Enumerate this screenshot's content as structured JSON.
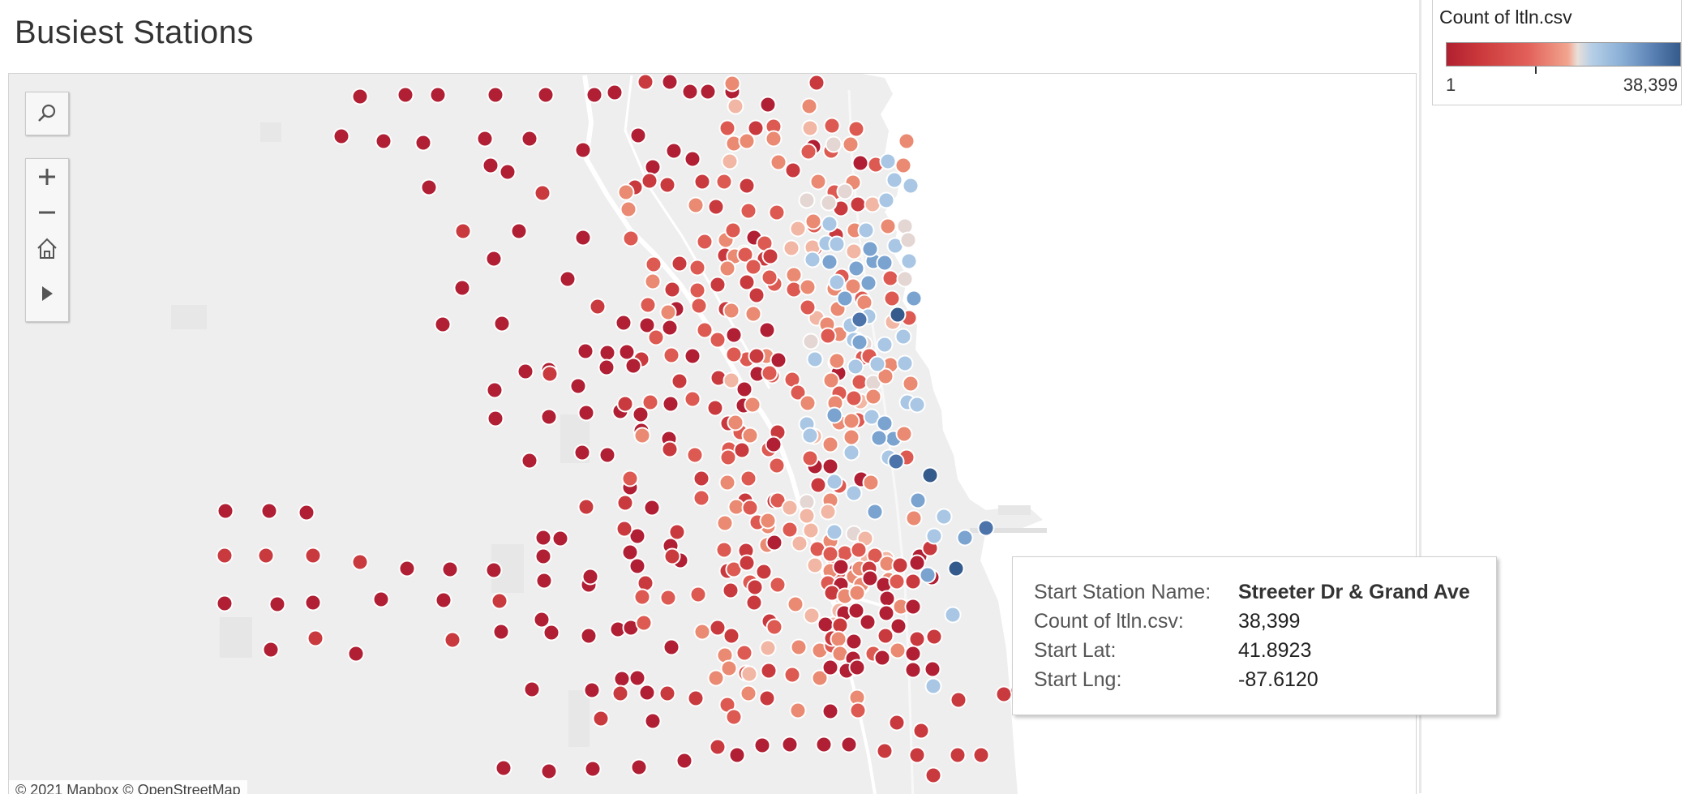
{
  "page_title": "Busiest Stations",
  "legend": {
    "title": "Count of ltln.csv",
    "min_label": "1",
    "max_label": "38,399",
    "color_low": "#b1202f",
    "color_mid": "#e9dfd9",
    "color_high": "#355a8c"
  },
  "map": {
    "attribution": "© 2021 Mapbox © OpenStreetMap",
    "colors": {
      "land": "#eeeeee",
      "water": "#ffffff",
      "roads": "#ffffff"
    },
    "controls": {
      "search_icon": "search-icon",
      "zoom_in_icon": "plus-icon",
      "zoom_out_icon": "minus-icon",
      "home_icon": "home-icon",
      "play_icon": "play-icon"
    }
  },
  "tooltip": {
    "rows": [
      {
        "key": "Start Station Name:",
        "value": "Streeter Dr & Grand Ave"
      },
      {
        "key": "Count of ltln.csv:",
        "value": "38,399"
      },
      {
        "key": "Start Lat:",
        "value": "41.8923"
      },
      {
        "key": "Start Lng:",
        "value": "-87.6120"
      }
    ]
  }
}
